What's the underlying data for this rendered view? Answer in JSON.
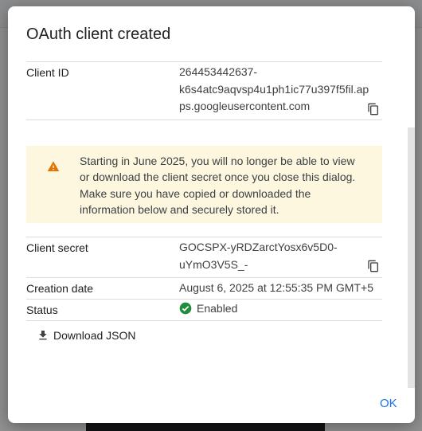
{
  "dialog": {
    "title": "OAuth client created",
    "client_id": {
      "label": "Client ID",
      "value_lines": [
        "264453442637-",
        "k6s4atc9aqvsp4u1ph1ic77u397f5fil.ap",
        "ps.googleusercontent.com"
      ]
    },
    "warning": {
      "icon": "warning-icon",
      "lines": [
        "Starting in June 2025, you will no longer be able to view",
        "or download the client secret once you close this dialog.",
        "Make sure you have copied or downloaded the",
        "information below and securely stored it."
      ]
    },
    "client_secret": {
      "label": "Client secret",
      "value_lines": [
        "GOCSPX-yRDZarctYosx6v5D0-",
        "uYmO3V5S_-"
      ]
    },
    "creation_date": {
      "label": "Creation date",
      "value": "August 6, 2025 at 12:55:35 PM GMT+5"
    },
    "status": {
      "label": "Status",
      "value": "Enabled",
      "icon": "check-circle-icon"
    },
    "download_button": {
      "label": "Download JSON",
      "icon": "download-icon"
    },
    "ok_button": {
      "label": "OK"
    }
  },
  "colors": {
    "accent": "#1a73e8",
    "warning_bg": "#fef7e0",
    "warning_icon": "#e37400",
    "success": "#1e8e3e"
  }
}
